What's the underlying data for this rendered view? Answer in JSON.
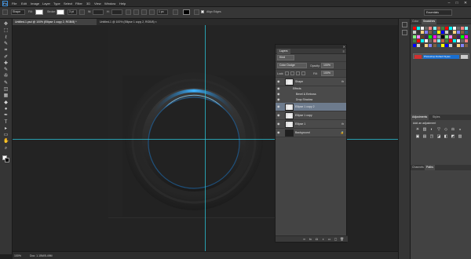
{
  "app": {
    "logo": "Ps"
  },
  "menubar": {
    "items": [
      "File",
      "Edit",
      "Image",
      "Layer",
      "Type",
      "Select",
      "Filter",
      "3D",
      "View",
      "Window",
      "Help"
    ],
    "window_controls": [
      "–",
      "□",
      "✕"
    ]
  },
  "options": {
    "tool_mode": "Shape",
    "fill_label": "Fill:",
    "stroke_label": "Stroke:",
    "stroke_width": "3 pt",
    "w_label": "W:",
    "w_value": "",
    "h_label": "H:",
    "h_value": "",
    "radius_value": "1 px",
    "align_edges_label": "Align Edges",
    "workspace": "Essentials"
  },
  "doctabs": [
    {
      "label": "Untitled-1.psd @ 100% (Ellipse 1 copy 2, RGB/8) *",
      "active": true
    },
    {
      "label": "Untitled-1 @ 100% (Ellipse 1 copy 2, RGB/8) ×",
      "active": false
    }
  ],
  "tools": [
    "move-tool-icon",
    "marquee-tool-icon",
    "lasso-tool-icon",
    "quick-select-tool-icon",
    "crop-tool-icon",
    "eyedropper-tool-icon",
    "healing-brush-icon",
    "brush-tool-icon",
    "clone-stamp-icon",
    "history-brush-icon",
    "eraser-tool-icon",
    "gradient-tool-icon",
    "blur-tool-icon",
    "dodge-tool-icon",
    "pen-tool-icon",
    "type-tool-icon",
    "path-select-icon",
    "shape-tool-icon",
    "hand-tool-icon",
    "zoom-tool-icon"
  ],
  "tool_glyphs": [
    "✥",
    "⬚",
    "ℓ",
    "✎",
    "⌗",
    "✐",
    "✚",
    "✎",
    "✇",
    "✎",
    "◫",
    "▦",
    "◆",
    "●",
    "✒",
    "T",
    "▸",
    "▭",
    "✋",
    "⌕"
  ],
  "layers_panel": {
    "title": "Layers",
    "menu_glyph": "≡",
    "kind_filter": "Kind",
    "blend_mode": "Color Dodge",
    "opacity_label": "Opacity:",
    "opacity_value": "100%",
    "lock_label": "Lock:",
    "fill_label": "Fill:",
    "fill_value": "100%",
    "layers": [
      {
        "name": "Shape",
        "fx": "fx",
        "selected": false
      },
      {
        "name": "Ellipse 1 copy 2",
        "fx": "",
        "selected": true
      },
      {
        "name": "Ellipse 1 copy",
        "fx": "",
        "selected": false
      },
      {
        "name": "Ellipse 1",
        "fx": "fx",
        "selected": false
      },
      {
        "name": "Background",
        "fx": "",
        "selected": false
      }
    ],
    "effects": {
      "label": "Effects",
      "items": [
        "Bevel & Emboss",
        "Drop Shadow"
      ]
    },
    "footer_icons": [
      "link-icon",
      "fx-icon",
      "mask-icon",
      "adjustment-icon",
      "folder-icon",
      "new-layer-icon",
      "trash-icon"
    ],
    "footer_glyphs": [
      "∞",
      "fx",
      "◘",
      "◑",
      "▭",
      "▢",
      "🗑"
    ]
  },
  "right_dock": {
    "swatch_tabs": [
      "Color",
      "Swatches"
    ],
    "styles_tabs": [
      "Styles"
    ],
    "adjustments_tabs": [
      "Adjustments",
      "Styles"
    ],
    "adjustments_title": "Add an adjustment",
    "adjustment_glyphs": [
      "☀",
      "▥",
      "◐",
      "▽",
      "◇",
      "⚖",
      "◒",
      "▣",
      "▤",
      "◳",
      "◪",
      "◧",
      "◩",
      "▨"
    ],
    "channels_tabs": [
      "Channels",
      "Paths"
    ],
    "selected_style": "Photoshop Default Styles"
  },
  "colors": {
    "guide": "#29c8de",
    "ring_glow": "#1d8fe0",
    "selected_layer": "#6d7b8d"
  },
  "statusbar": {
    "zoom": "100%",
    "doc_info": "Doc: 1.15M/5.49M"
  }
}
